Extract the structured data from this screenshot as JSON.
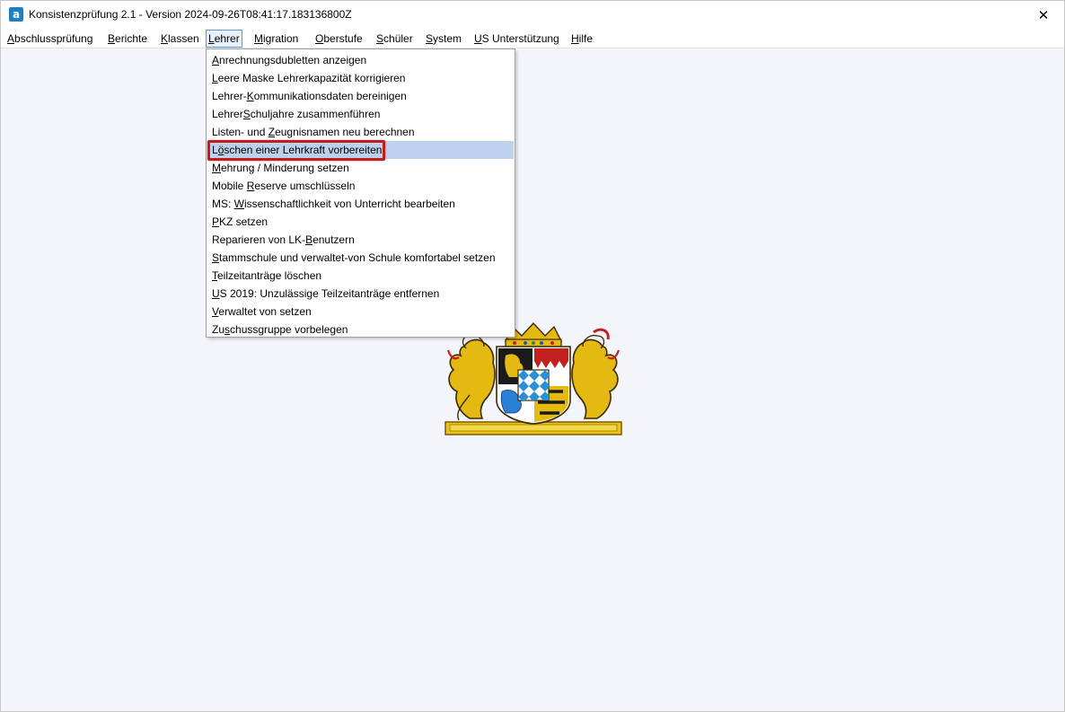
{
  "window": {
    "title": "Konsistenzprüfung 2.1 - Version 2024-09-26T08:41:17.183136800Z",
    "app_icon_letter": "a",
    "close_glyph": "✕"
  },
  "menubar": [
    {
      "pre": "",
      "acc": "A",
      "post": "bschlussprüfung"
    },
    {
      "pre": "",
      "acc": "B",
      "post": "erichte"
    },
    {
      "pre": "",
      "acc": "K",
      "post": "lassen"
    },
    {
      "pre": "",
      "acc": "L",
      "post": "ehrer"
    },
    {
      "pre": "",
      "acc": "M",
      "post": "igration"
    },
    {
      "pre": "",
      "acc": "O",
      "post": "berstufe"
    },
    {
      "pre": "",
      "acc": "S",
      "post": "chüler"
    },
    {
      "pre": "",
      "acc": "S",
      "post": "ystem"
    },
    {
      "pre": "",
      "acc": "U",
      "post": "S Unterstützung"
    },
    {
      "pre": "",
      "acc": "H",
      "post": "ilfe"
    }
  ],
  "dropdown": [
    {
      "pre": "",
      "acc": "A",
      "post": "nrechnungsdubletten anzeigen"
    },
    {
      "pre": "",
      "acc": "L",
      "post": "eere Maske Lehrerkapazität korrigieren"
    },
    {
      "pre": "Lehrer-",
      "acc": "K",
      "post": "ommunikationsdaten bereinigen"
    },
    {
      "pre": "Lehrer",
      "acc": "S",
      "post": "chuljahre zusammenführen"
    },
    {
      "pre": "Listen- und ",
      "acc": "Z",
      "post": "eugnisnamen neu berechnen"
    },
    {
      "pre": "L",
      "acc": "ö",
      "post": "schen einer Lehrkraft vorbereiten"
    },
    {
      "pre": "",
      "acc": "M",
      "post": "ehrung / Minderung setzen"
    },
    {
      "pre": "Mobile ",
      "acc": "R",
      "post": "eserve umschlüsseln"
    },
    {
      "pre": "MS: ",
      "acc": "W",
      "post": "issenschaftlichkeit von Unterricht bearbeiten"
    },
    {
      "pre": "",
      "acc": "P",
      "post": "KZ setzen"
    },
    {
      "pre": "Reparieren von LK-",
      "acc": "B",
      "post": "enutzern"
    },
    {
      "pre": "",
      "acc": "S",
      "post": "tammschule und verwaltet-von Schule komfortabel setzen"
    },
    {
      "pre": "",
      "acc": "T",
      "post": "eilzeitanträge löschen"
    },
    {
      "pre": "",
      "acc": "U",
      "post": "S 2019: Unzulässige Teilzeitanträge entfernen"
    },
    {
      "pre": "",
      "acc": "V",
      "post": "erwaltet von setzen"
    },
    {
      "pre": "Zu",
      "acc": "s",
      "post": "chussgruppe vorbelegen"
    }
  ],
  "colors": {
    "highlight_row": "#bcd2ec",
    "highlight_box": "#c21d1d",
    "app_icon": "#1b7fc4"
  }
}
